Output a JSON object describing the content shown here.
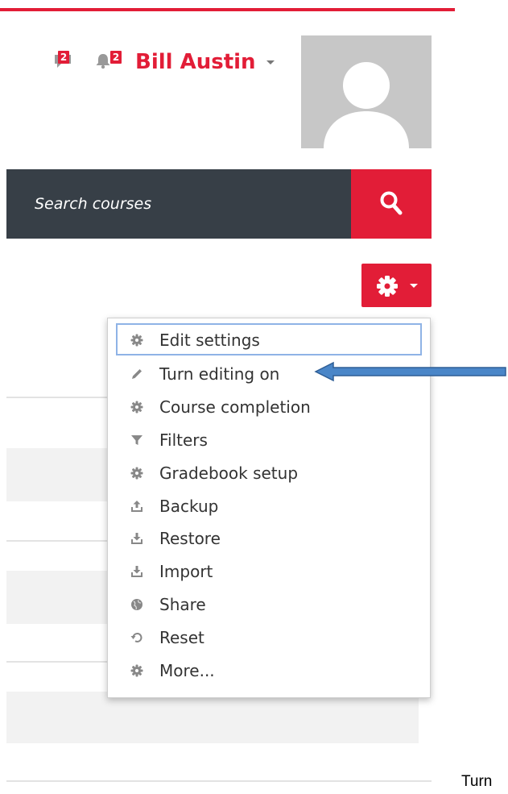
{
  "header": {
    "messages_badge": "2",
    "notifications_badge": "2",
    "user_name": "Bill Austin",
    "accent_color": "#e21d37"
  },
  "search": {
    "placeholder": "Search courses"
  },
  "actions_menu": {
    "items": [
      {
        "label": "Edit settings",
        "icon": "gear-icon"
      },
      {
        "label": "Turn editing on",
        "icon": "pencil-icon"
      },
      {
        "label": "Course completion",
        "icon": "gear-icon"
      },
      {
        "label": "Filters",
        "icon": "filter-icon"
      },
      {
        "label": "Gradebook setup",
        "icon": "gear-icon"
      },
      {
        "label": "Backup",
        "icon": "upload-icon"
      },
      {
        "label": "Restore",
        "icon": "download-icon"
      },
      {
        "label": "Import",
        "icon": "download-icon"
      },
      {
        "label": "Share",
        "icon": "globe-icon"
      },
      {
        "label": "Reset",
        "icon": "reset-icon"
      },
      {
        "label": "More...",
        "icon": "gear-icon"
      }
    ]
  },
  "annotation": {
    "text": "Turn"
  }
}
